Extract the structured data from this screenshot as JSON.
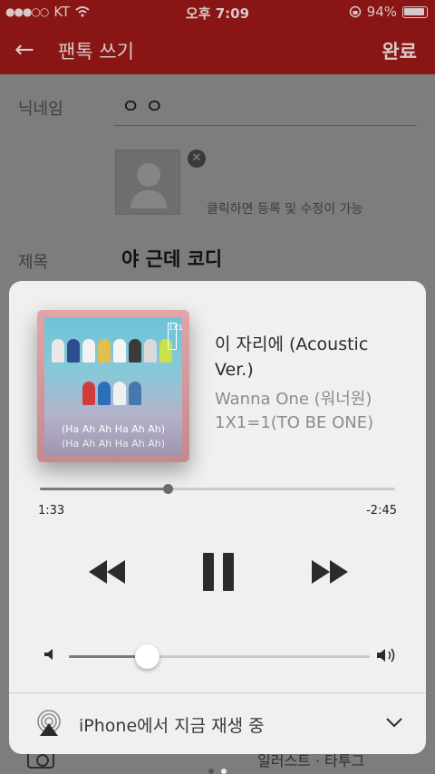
{
  "status_bar": {
    "carrier": "KT",
    "time": "오후 7:09",
    "battery": "94%"
  },
  "nav": {
    "title": "팬톡 쓰기",
    "done_label": "완료"
  },
  "form": {
    "nickname_label": "닉네임",
    "nickname_value": "ㅇㅇ",
    "photo_hint": "클릭하면 등록 및 수정이 가능",
    "title_label": "제목",
    "title_value": "야 근데 코디",
    "bottom_text": "일러스트 · 타투그"
  },
  "player": {
    "track_title": "이 자리에 (Acoustic Ver.)",
    "artist": "Wanna One (워너원)",
    "album": "1X1=1(TO BE ONE)",
    "album_caption_1": "(Ha Ah Ah Ha Ah Ah)",
    "album_caption_2": "(Ha Ah Ah Ha Ah Ah)",
    "album_tag": "1X1",
    "elapsed": "1:33",
    "remaining": "-2:45",
    "progress_fraction": 0.36,
    "volume_fraction": 0.26,
    "airplay_label": "iPhone에서 지금 재생 중"
  },
  "colors": {
    "brand_red": "#8a1515",
    "card_bg": "#f0f0f0"
  },
  "page_indicator": {
    "count": 2,
    "active_index": 1
  }
}
